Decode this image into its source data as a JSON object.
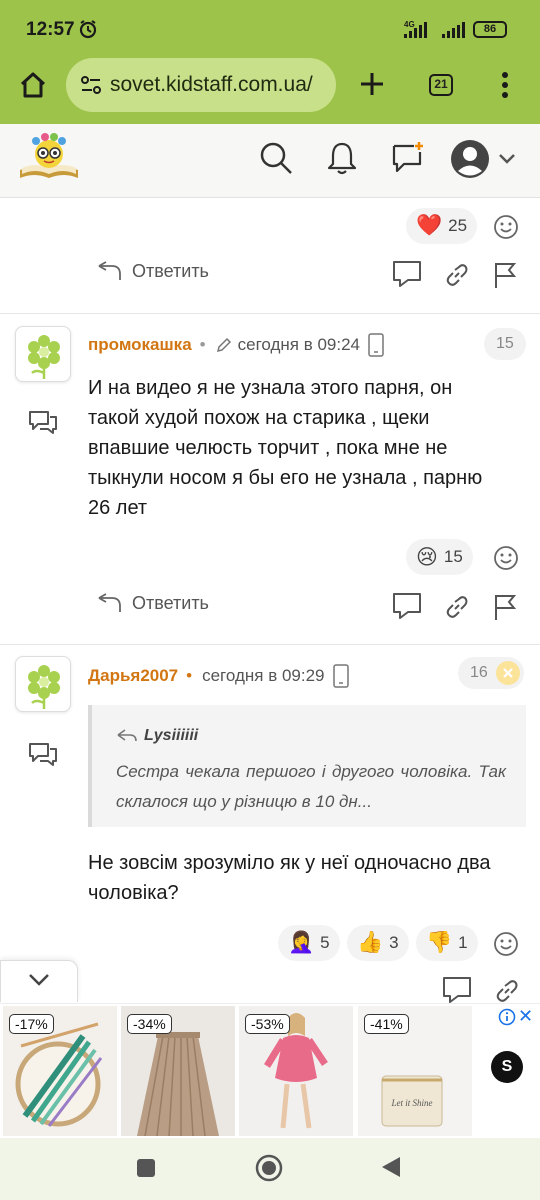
{
  "status_bar": {
    "time": "12:57",
    "network_label": "4G",
    "battery": "86"
  },
  "browser": {
    "url": "sovet.kidstaff.com.ua/",
    "tab_count": "21"
  },
  "comments": [
    {
      "reactions": [
        {
          "icon": "heart-icon",
          "emoji": "❤️",
          "count": "25"
        }
      ],
      "reply_label": "Ответить"
    },
    {
      "author": "промокашка",
      "time": "сегодня в 09:24",
      "number": "15",
      "text": "И на видео я не узнала этого парня, он такой худой похож на старика , щеки впавшие челюсть торчит , пока мне не тыкнули носом я бы его не узнала , парню 26 лет",
      "reactions": [
        {
          "icon": "crying-face-icon",
          "emoji": "😢",
          "count": "15"
        }
      ],
      "reply_label": "Ответить"
    },
    {
      "author": "Дарья2007",
      "time": "сегодня в 09:29",
      "number": "16",
      "quote": {
        "author": "Lysiiiiii",
        "text": "Сестра чекала першого і другого чоловіка. Так склалося що у різницю в 10 дн..."
      },
      "text": "Не зовсім зрозуміло як у неї одночасно два чоловіка?",
      "reactions": [
        {
          "icon": "facepalm-icon",
          "emoji": "🤦‍♀️",
          "count": "5"
        },
        {
          "icon": "thumbs-up-icon",
          "emoji": "👍",
          "count": "3"
        },
        {
          "icon": "thumbs-down-icon",
          "emoji": "👎",
          "count": "1"
        }
      ]
    }
  ],
  "ads": [
    {
      "discount": "-17%",
      "image": "cross-stitch-hoop-image"
    },
    {
      "discount": "-34%",
      "image": "pleated-skirt-image"
    },
    {
      "discount": "-53%",
      "image": "pink-dress-image"
    },
    {
      "discount": "-41%",
      "image": "cosmetic-bag-image",
      "bag_text": "Let it Shine"
    }
  ],
  "ad_logo": "S",
  "colors": {
    "accent_green": "#9ec34a",
    "author_orange": "#d27613"
  }
}
